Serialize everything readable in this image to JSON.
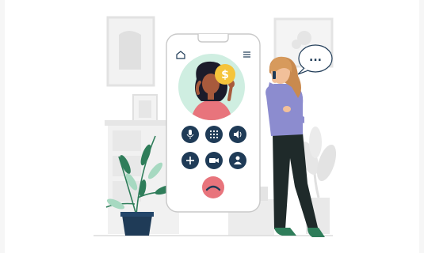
{
  "illustration": {
    "phone_screen": {
      "buttons": [
        {
          "name": "mute-button",
          "icon": "microphone-icon"
        },
        {
          "name": "keypad-button",
          "icon": "keypad-icon"
        },
        {
          "name": "speaker-button",
          "icon": "speaker-icon"
        },
        {
          "name": "add-call-button",
          "icon": "plus-icon"
        },
        {
          "name": "video-button",
          "icon": "video-camera-icon"
        },
        {
          "name": "contacts-button",
          "icon": "contact-icon"
        }
      ],
      "end_call": {
        "name": "end-call-button",
        "icon": "hang-up-icon"
      }
    },
    "speech_bubble": {
      "text": "..."
    },
    "colors": {
      "navy": "#1f3b57",
      "green": "#2f7d5a",
      "pink": "#e8747c",
      "teal_bg": "#cfeee1",
      "gold": "#f5c43b",
      "purple": "#8c8ccf",
      "furniture": "#ececec"
    }
  }
}
